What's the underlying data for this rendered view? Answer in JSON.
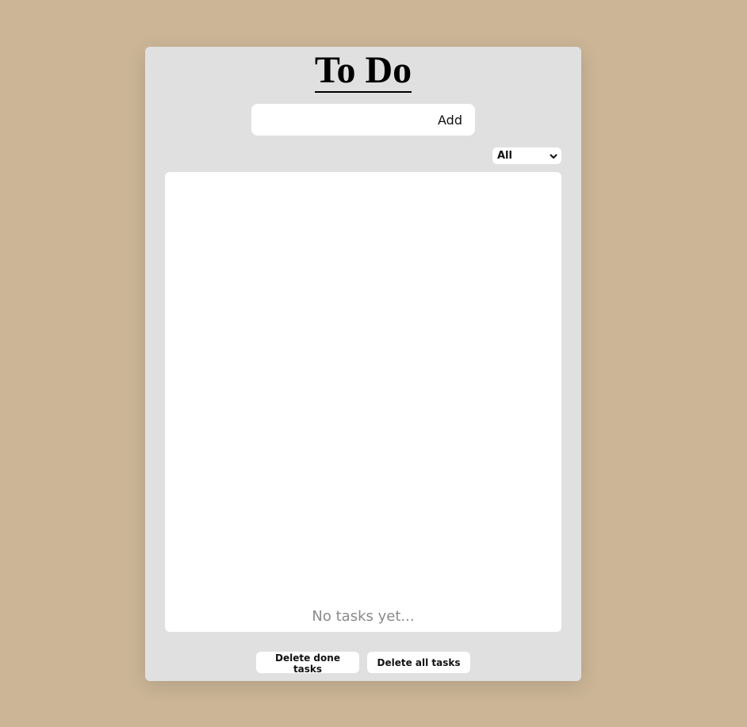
{
  "app": {
    "title": "To Do"
  },
  "add_form": {
    "input_value": "",
    "input_placeholder": "",
    "add_label": "Add"
  },
  "filter": {
    "selected": "All",
    "icon": "chevron-down-icon"
  },
  "task_list": {
    "tasks": [],
    "empty_message": "No tasks yet..."
  },
  "actions": {
    "delete_done_label": "Delete done tasks",
    "delete_all_label": "Delete all tasks"
  },
  "colors": {
    "background": "#cbb596",
    "card": "#e0e0e0",
    "panel": "#ffffff",
    "empty_text": "#8a8a8a"
  }
}
